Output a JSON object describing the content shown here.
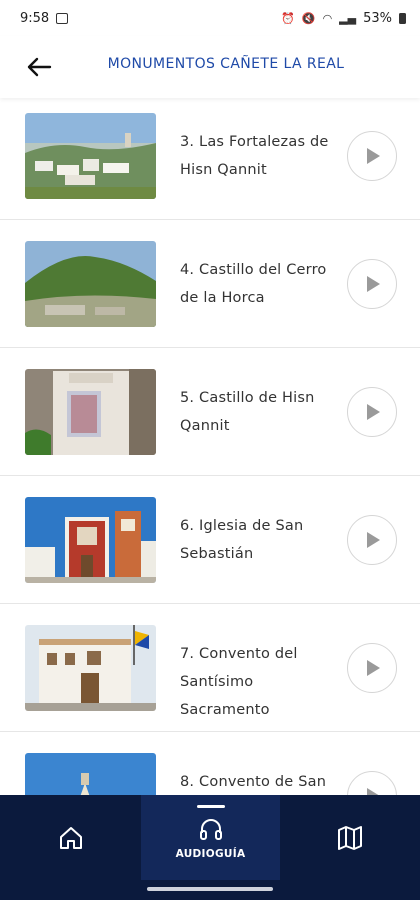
{
  "status": {
    "time": "9:58",
    "battery": "53%"
  },
  "header": {
    "title": "MONUMENTOS CAÑETE LA REAL"
  },
  "items": [
    {
      "title": "3. Las Fortalezas de Hisn Qannit"
    },
    {
      "title": "4. Castillo del Cerro de la Horca"
    },
    {
      "title": "5. Castillo de Hisn Qannit"
    },
    {
      "title": "6. Iglesia de San Sebastián"
    },
    {
      "title": "7. Convento del Santísimo Sacramento"
    },
    {
      "title": "8. Convento de San"
    }
  ],
  "nav": {
    "active_label": "AUDIOGUÍA"
  },
  "colors": {
    "title_blue": "#1f4aa8",
    "nav_bg": "#0b1a3d",
    "nav_active_bg": "#13285a"
  },
  "icons": [
    "arrow-left-icon",
    "play-icon",
    "home-icon",
    "headphones-icon",
    "map-icon"
  ]
}
